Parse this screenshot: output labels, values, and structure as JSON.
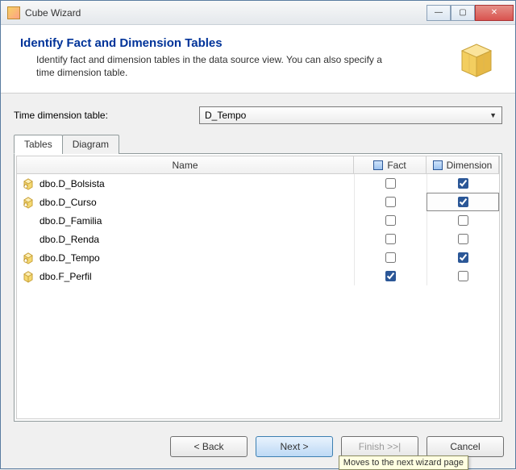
{
  "window": {
    "title": "Cube Wizard"
  },
  "header": {
    "title": "Identify Fact and Dimension Tables",
    "description": "Identify fact and dimension tables in the data source view. You can also specify a time dimension table."
  },
  "timeDimension": {
    "label": "Time dimension table:",
    "value": "D_Tempo"
  },
  "tabs": {
    "tables": "Tables",
    "diagram": "Diagram"
  },
  "grid": {
    "columns": {
      "name": "Name",
      "fact": "Fact",
      "dimension": "Dimension"
    },
    "rows": [
      {
        "icon": "dim",
        "name": "dbo.D_Bolsista",
        "fact": false,
        "dimension": true,
        "selected": false
      },
      {
        "icon": "dim",
        "name": "dbo.D_Curso",
        "fact": false,
        "dimension": true,
        "selected": true
      },
      {
        "icon": "none",
        "name": "dbo.D_Familia",
        "fact": false,
        "dimension": false,
        "selected": false
      },
      {
        "icon": "none",
        "name": "dbo.D_Renda",
        "fact": false,
        "dimension": false,
        "selected": false
      },
      {
        "icon": "dim",
        "name": "dbo.D_Tempo",
        "fact": false,
        "dimension": true,
        "selected": false
      },
      {
        "icon": "fact",
        "name": "dbo.F_Perfil",
        "fact": true,
        "dimension": false,
        "selected": false
      }
    ]
  },
  "footer": {
    "back": "< Back",
    "next": "Next >",
    "finish": "Finish >>|",
    "cancel": "Cancel",
    "tooltip": "Moves to the next wizard page"
  }
}
